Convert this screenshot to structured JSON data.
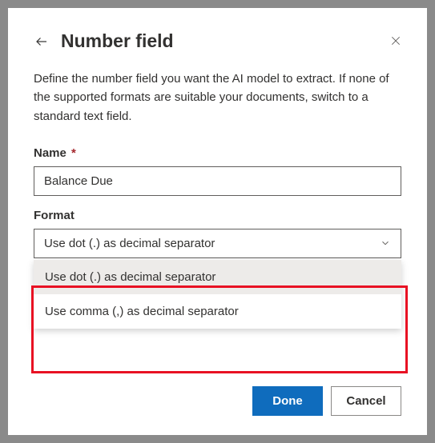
{
  "dialog": {
    "title": "Number field",
    "description": "Define the number field you want the AI model to extract. If none of the supported formats are suitable your documents, switch to a standard text field."
  },
  "nameField": {
    "label": "Name",
    "required": "*",
    "value": "Balance Due"
  },
  "formatField": {
    "label": "Format",
    "selected": "Use dot (.) as decimal separator",
    "options": [
      "Use dot (.) as decimal separator",
      "Use comma (,) as decimal separator"
    ]
  },
  "buttons": {
    "primary": "Done",
    "secondary": "Cancel"
  }
}
